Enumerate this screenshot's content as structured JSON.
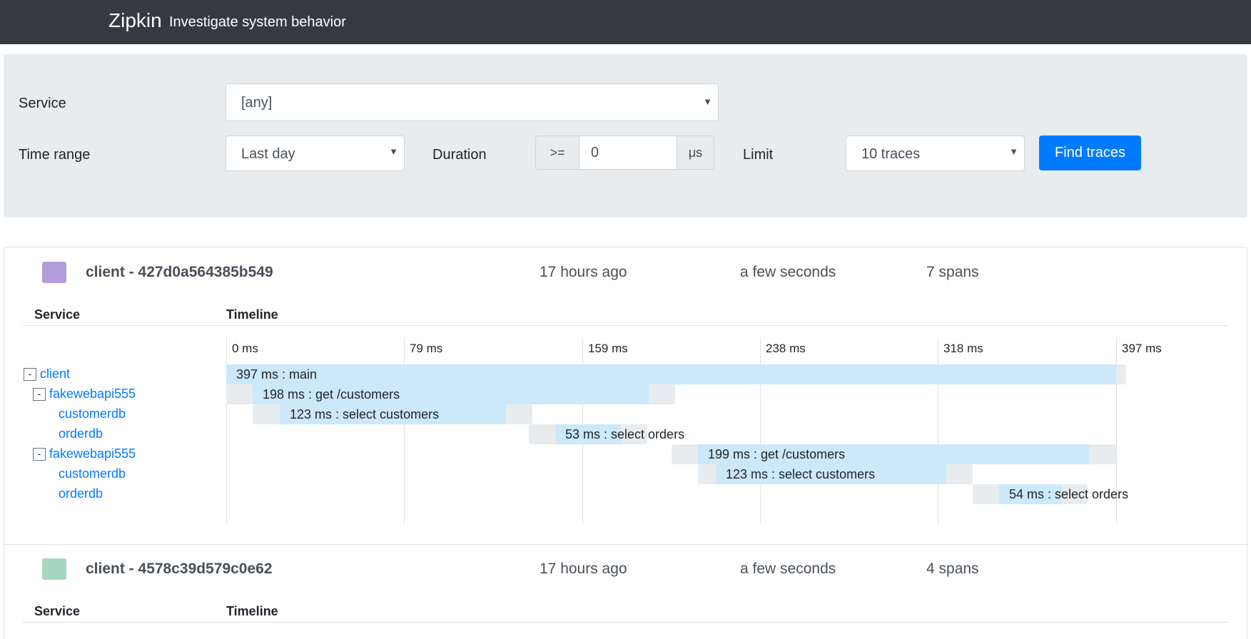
{
  "navbar": {
    "brand": "Zipkin",
    "tagline": "Investigate system behavior"
  },
  "search": {
    "service_label": "Service",
    "service_value": "[any]",
    "time_range_label": "Time range",
    "time_range_value": "Last day",
    "duration_label": "Duration",
    "duration_operator": ">=",
    "duration_value": "0",
    "duration_unit": "μs",
    "limit_label": "Limit",
    "limit_value": "10 traces",
    "find_button": "Find traces"
  },
  "traces": [
    {
      "title": "client - 427d0a564385b549",
      "time_ago": "17 hours ago",
      "duration": "a few seconds",
      "spans_count": "7 spans",
      "color": "#b39ddb",
      "service_header": "Service",
      "timeline_header": "Timeline",
      "ticks": [
        "0 ms",
        "79 ms",
        "159 ms",
        "238 ms",
        "318 ms",
        "397 ms"
      ],
      "rows": [
        {
          "service": "client",
          "toggle": "-",
          "label": "397 ms : main"
        },
        {
          "service": "fakewebapi555",
          "toggle": "-",
          "label": "198 ms : get /customers"
        },
        {
          "service": "customerdb",
          "label": "123 ms : select customers"
        },
        {
          "service": "orderdb",
          "label": "53 ms : select orders"
        },
        {
          "service": "fakewebapi555",
          "toggle": "-",
          "label": "199 ms : get /customers"
        },
        {
          "service": "customerdb",
          "label": "123 ms : select customers"
        },
        {
          "service": "orderdb",
          "label": "54 ms : select orders"
        }
      ]
    },
    {
      "title": "client - 4578c39d579c0e62",
      "time_ago": "17 hours ago",
      "duration": "a few seconds",
      "spans_count": "4 spans",
      "color": "#a5d6bf",
      "service_header": "Service",
      "timeline_header": "Timeline"
    }
  ]
}
